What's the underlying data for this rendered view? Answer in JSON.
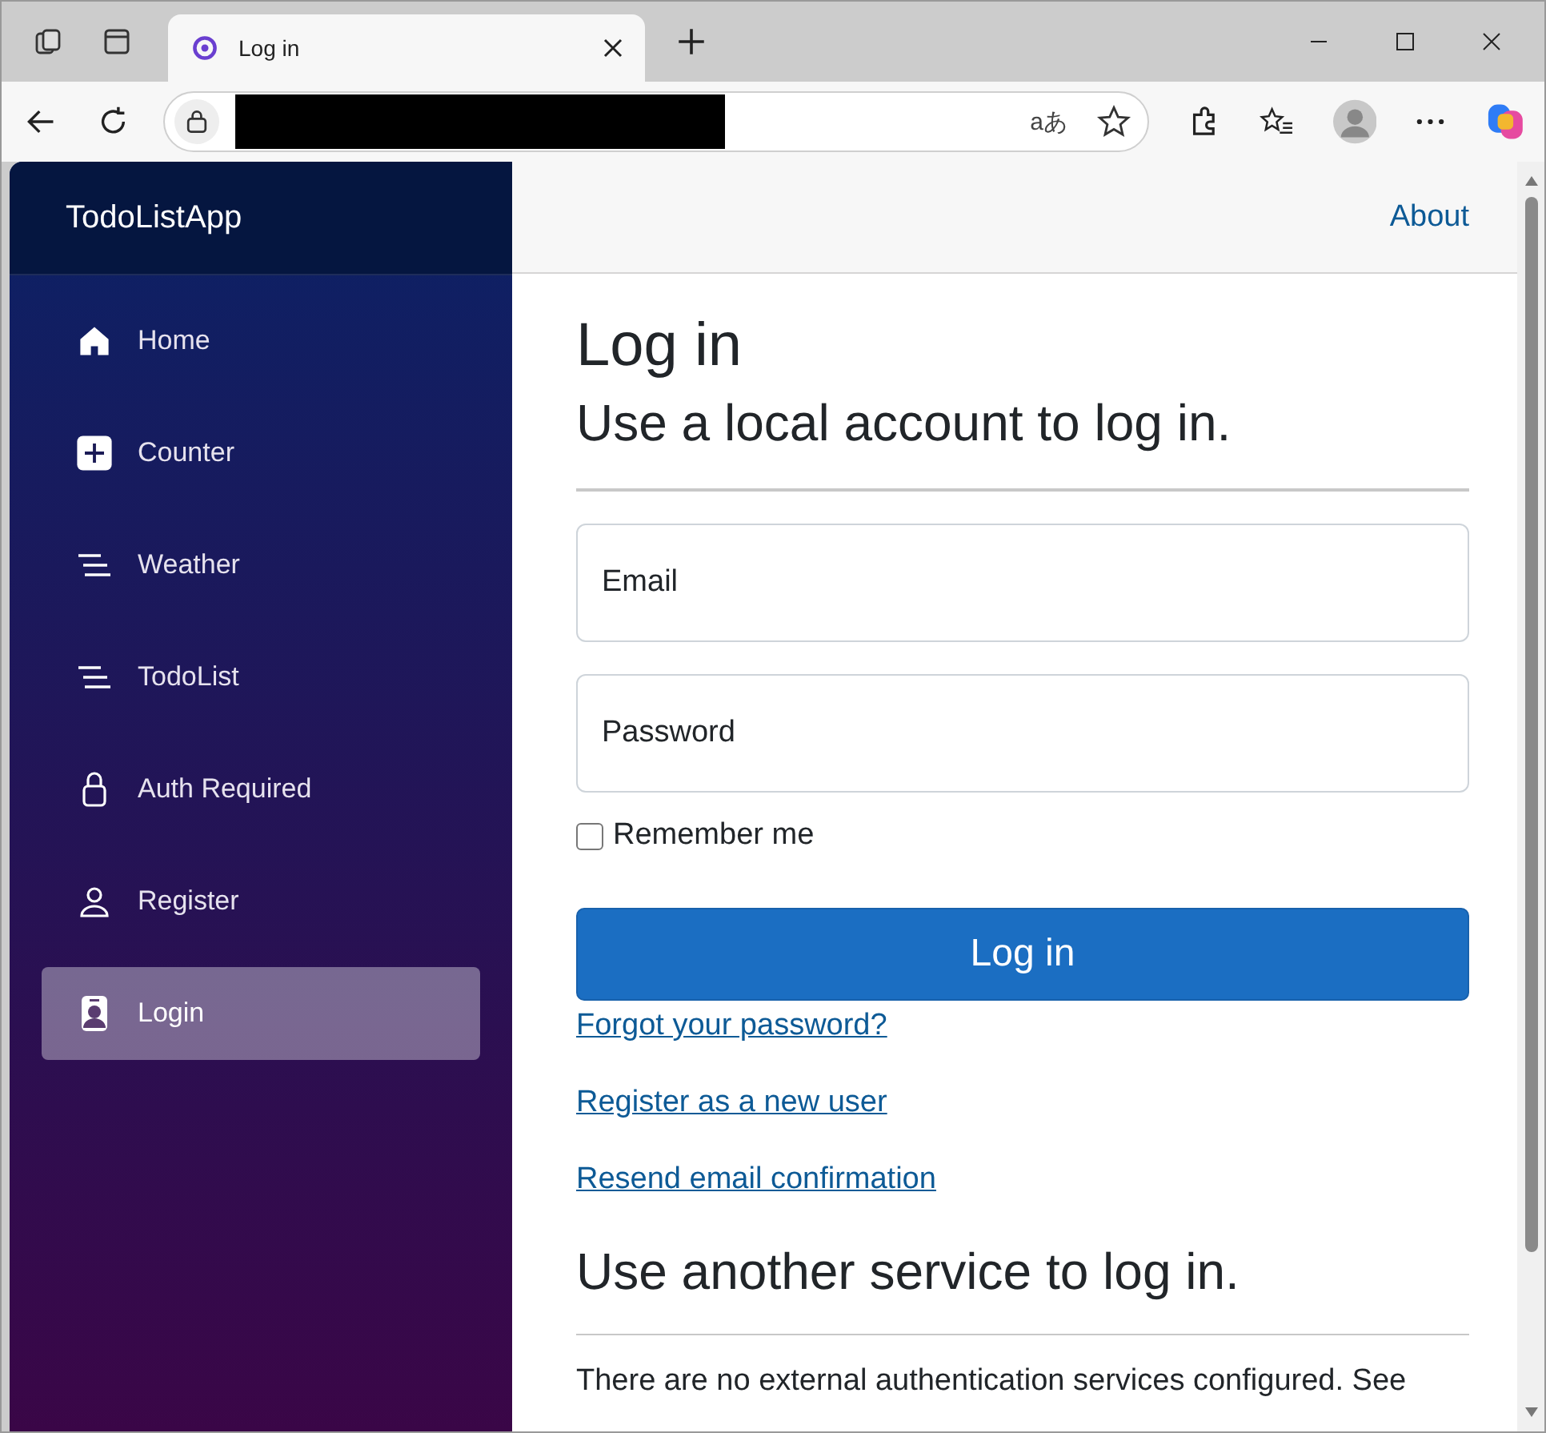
{
  "browser": {
    "tab": {
      "title": "Log in"
    },
    "translate_label": "aあ"
  },
  "sidebar": {
    "brand": "TodoListApp",
    "items": [
      {
        "label": "Home",
        "selected": false
      },
      {
        "label": "Counter",
        "selected": false
      },
      {
        "label": "Weather",
        "selected": false
      },
      {
        "label": "TodoList",
        "selected": false
      },
      {
        "label": "Auth Required",
        "selected": false
      },
      {
        "label": "Register",
        "selected": false
      },
      {
        "label": "Login",
        "selected": true
      }
    ]
  },
  "top_bar": {
    "link": "About"
  },
  "page": {
    "title": "Log in",
    "subtitle": "Use a local account to log in.",
    "fields": [
      {
        "placeholder": "Email"
      },
      {
        "placeholder": "Password"
      }
    ],
    "remember": {
      "label": "Remember me",
      "checked": false
    },
    "submit": "Log in",
    "links": [
      "Forgot your password?",
      "Register as a new user",
      "Resend email confirmation"
    ],
    "external_title": "Use another service to log in.",
    "external_text": "There are no external authentication services configured. See"
  }
}
